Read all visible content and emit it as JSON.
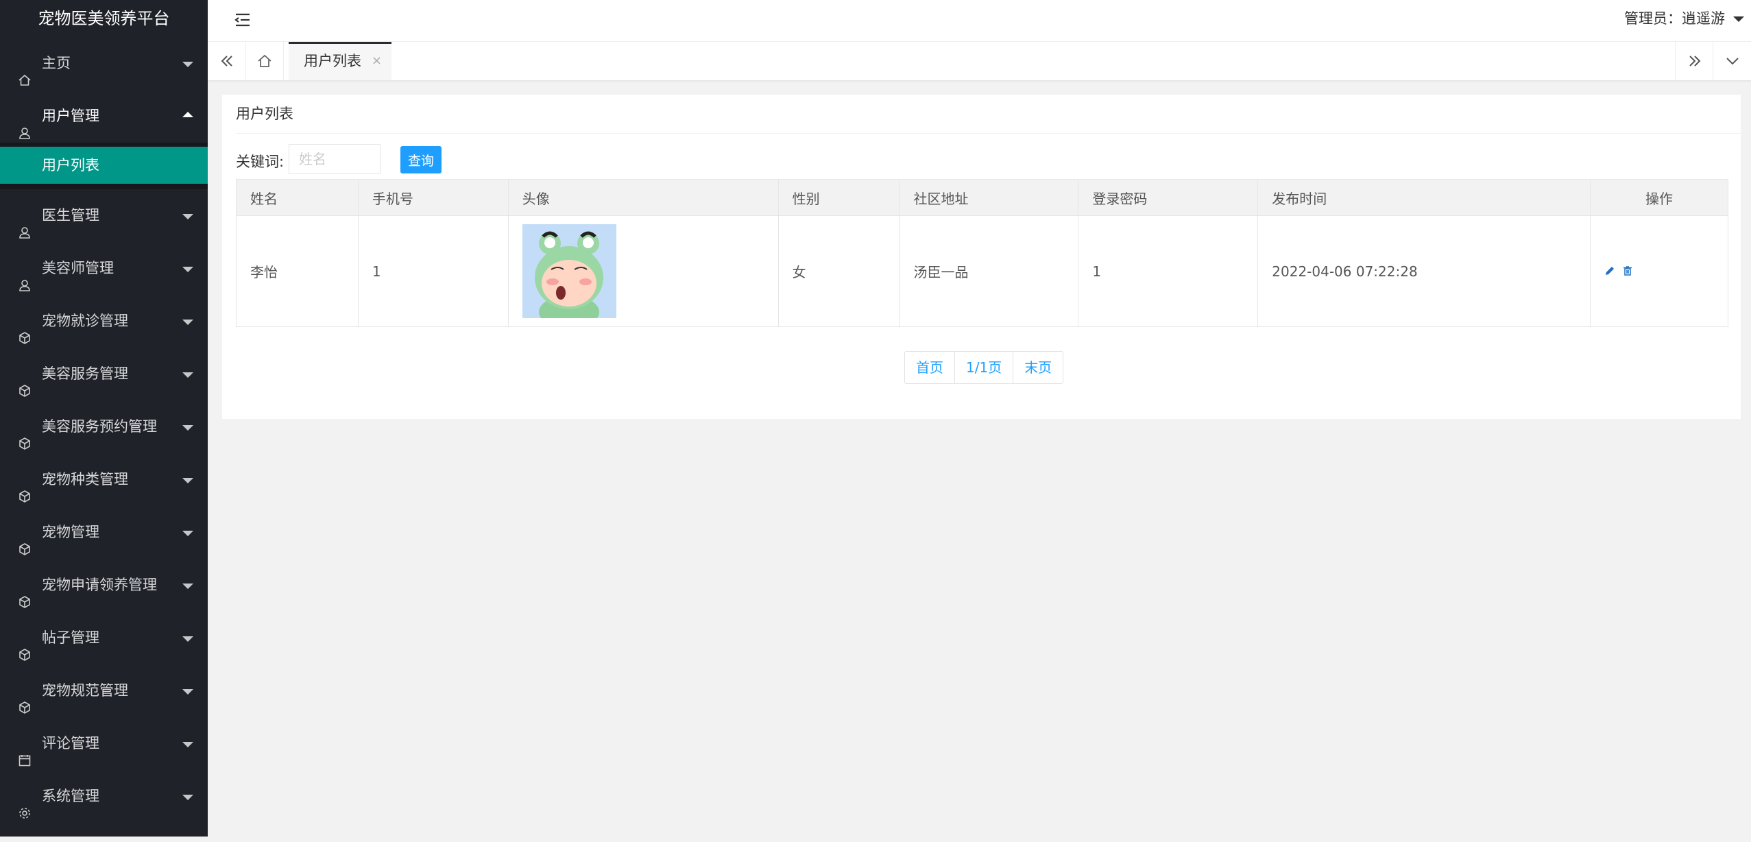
{
  "app": {
    "title": "宠物医美领养平台"
  },
  "header": {
    "user": "管理员：逍遥游"
  },
  "sidebar": {
    "items": [
      {
        "label": "主页",
        "icon": "home-icon",
        "open": false
      },
      {
        "label": "用户管理",
        "icon": "user-icon",
        "open": true,
        "children": [
          {
            "label": "用户列表",
            "active": true
          }
        ]
      },
      {
        "label": "医生管理",
        "icon": "user-icon",
        "open": false
      },
      {
        "label": "美容师管理",
        "icon": "user-icon",
        "open": false
      },
      {
        "label": "宠物就诊管理",
        "icon": "cube-icon",
        "open": false
      },
      {
        "label": "美容服务管理",
        "icon": "cube-icon",
        "open": false
      },
      {
        "label": "美容服务预约管理",
        "icon": "cube-icon",
        "open": false
      },
      {
        "label": "宠物种类管理",
        "icon": "cube-icon",
        "open": false
      },
      {
        "label": "宠物管理",
        "icon": "cube-icon",
        "open": false
      },
      {
        "label": "宠物申请领养管理",
        "icon": "cube-icon",
        "open": false
      },
      {
        "label": "帖子管理",
        "icon": "cube-icon",
        "open": false
      },
      {
        "label": "宠物规范管理",
        "icon": "cube-icon",
        "open": false
      },
      {
        "label": "评论管理",
        "icon": "calendar-icon",
        "open": false
      },
      {
        "label": "系统管理",
        "icon": "gear-icon",
        "open": false
      }
    ]
  },
  "tabs": {
    "active": {
      "label": "用户列表",
      "close": "×"
    }
  },
  "main": {
    "card_title": "用户列表",
    "search": {
      "label": "关键词:",
      "placeholder": "姓名",
      "value": "",
      "button": "查询"
    },
    "table": {
      "headers": [
        "姓名",
        "手机号",
        "头像",
        "性别",
        "社区地址",
        "登录密码",
        "发布时间",
        "操作"
      ],
      "rows": [
        {
          "name": "李怡",
          "phone": "1",
          "avatar": "frog-hood-avatar",
          "gender": "女",
          "address": "汤臣一品",
          "password": "1",
          "time": "2022-04-06 07:22:28"
        }
      ]
    },
    "pager": {
      "first": "首页",
      "page": "1/1页",
      "last": "末页"
    }
  },
  "colors": {
    "sidebar_bg": "#20222a",
    "accent": "#009688",
    "primary": "#1e9fff"
  }
}
